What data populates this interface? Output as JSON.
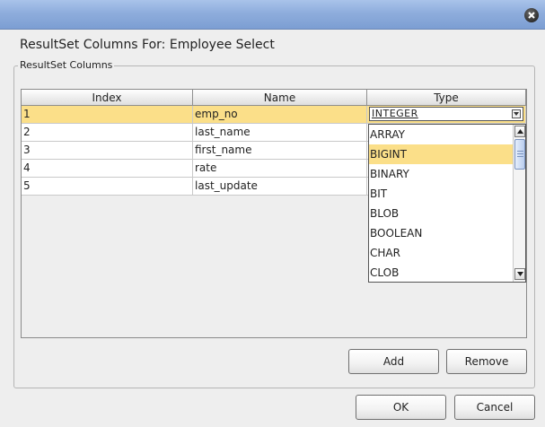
{
  "window": {
    "close_glyph": "✕"
  },
  "dialog": {
    "title": "ResultSet Columns For: Employee Select"
  },
  "group": {
    "label": "ResultSet Columns"
  },
  "table": {
    "headers": [
      "Index",
      "Name",
      "Type"
    ],
    "rows": [
      {
        "index": "1",
        "name": "emp_no",
        "type": "INTEGER",
        "selected": true
      },
      {
        "index": "2",
        "name": "last_name"
      },
      {
        "index": "3",
        "name": "first_name"
      },
      {
        "index": "4",
        "name": "rate"
      },
      {
        "index": "5",
        "name": "last_update"
      }
    ]
  },
  "type_dropdown": {
    "selected_value": "INTEGER",
    "options": [
      "ARRAY",
      "BIGINT",
      "BINARY",
      "BIT",
      "BLOB",
      "BOOLEAN",
      "CHAR",
      "CLOB"
    ],
    "highlighted": "BIGINT"
  },
  "buttons": {
    "add": "Add",
    "remove": "Remove",
    "ok": "OK",
    "cancel": "Cancel"
  },
  "colors": {
    "titlebar": "#8eaddc",
    "selection": "#fbdf89",
    "background": "#eeeeee"
  }
}
